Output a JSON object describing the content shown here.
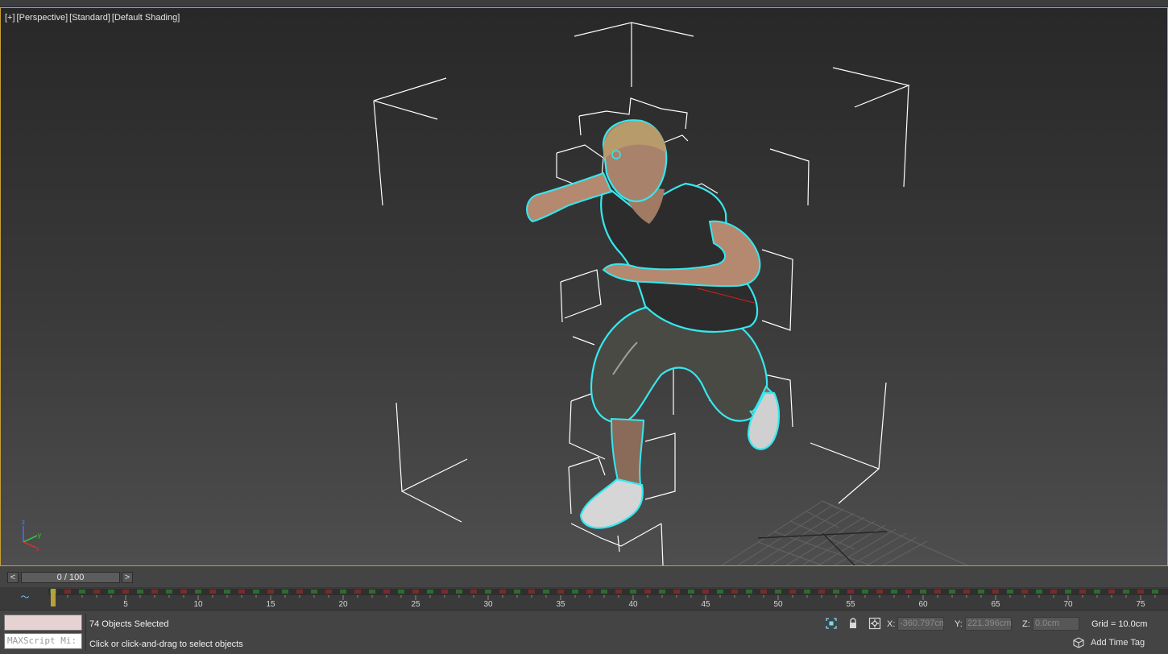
{
  "viewport": {
    "labels": [
      "[+]",
      "[Perspective]",
      "[Standard]",
      "[Default Shading]"
    ],
    "axis_labels": {
      "x": "x",
      "y": "y",
      "z": "z"
    }
  },
  "timeline": {
    "prev_label": "<",
    "next_label": ">",
    "frame_display": "0 / 100",
    "tick_labels": [
      "5",
      "10",
      "15",
      "20",
      "25",
      "30",
      "35",
      "40",
      "45",
      "50",
      "55",
      "60",
      "65",
      "70",
      "75"
    ]
  },
  "status": {
    "maxscript_placeholder": "MAXScript Mi:",
    "selection": "74 Objects Selected",
    "prompt": "Click or click-and-drag to select objects",
    "x_label": "X:",
    "x_value": "-360.797cm",
    "y_label": "Y:",
    "y_value": "221.396cm",
    "z_label": "Z:",
    "z_value": "0.0cm",
    "grid": "Grid = 10.0cm",
    "time_tag": "Add Time Tag"
  },
  "colors": {
    "viewport_border": "#c7a032",
    "selection_outline": "#35e8f0",
    "bounding_boxes": "#ffffff"
  }
}
